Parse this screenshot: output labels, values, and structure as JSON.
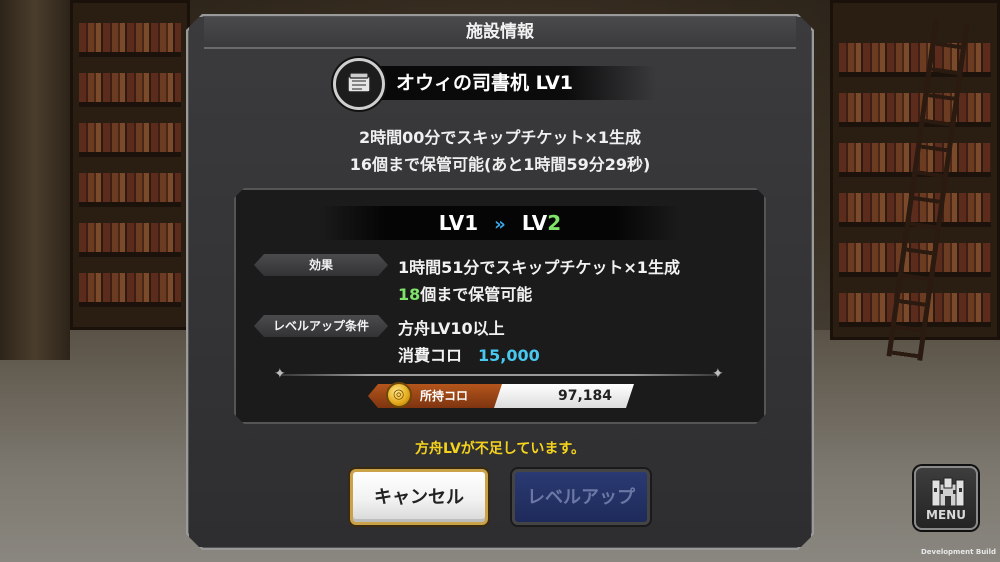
{
  "dialog": {
    "title": "施設情報",
    "facility_name": "オウィの司書机 LV1",
    "current_effect_line1": "2時間00分でスキップチケット×1生成",
    "current_effect_line2": "16個まで保管可能(あと1時間59分29秒)"
  },
  "upgrade": {
    "from_level": "LV1",
    "arrow": "»",
    "to_level_prefix": "LV",
    "to_level_num": "2",
    "effect_tag": "効果",
    "effect_line1": "1時間51分でスキップチケット×1生成",
    "effect_line2_num": "18",
    "effect_line2_rest": "個まで保管可能",
    "condition_tag": "レベルアップ条件",
    "condition_text": "方舟LV10以上",
    "cost_label": "消費コロ",
    "cost_value": "15,000"
  },
  "wallet": {
    "label": "所持コロ",
    "value": "97,184"
  },
  "warning": "方舟LVが不足しています。",
  "buttons": {
    "cancel": "キャンセル",
    "levelup": "レベルアップ"
  },
  "menu": {
    "label": "MENU"
  },
  "footer": {
    "dev_build": "Development Build"
  },
  "colors": {
    "accent_green": "#7fe36a",
    "accent_cyan": "#48c8ef",
    "warning_yellow": "#f5d31c",
    "arrow_blue": "#3ba8e8"
  }
}
